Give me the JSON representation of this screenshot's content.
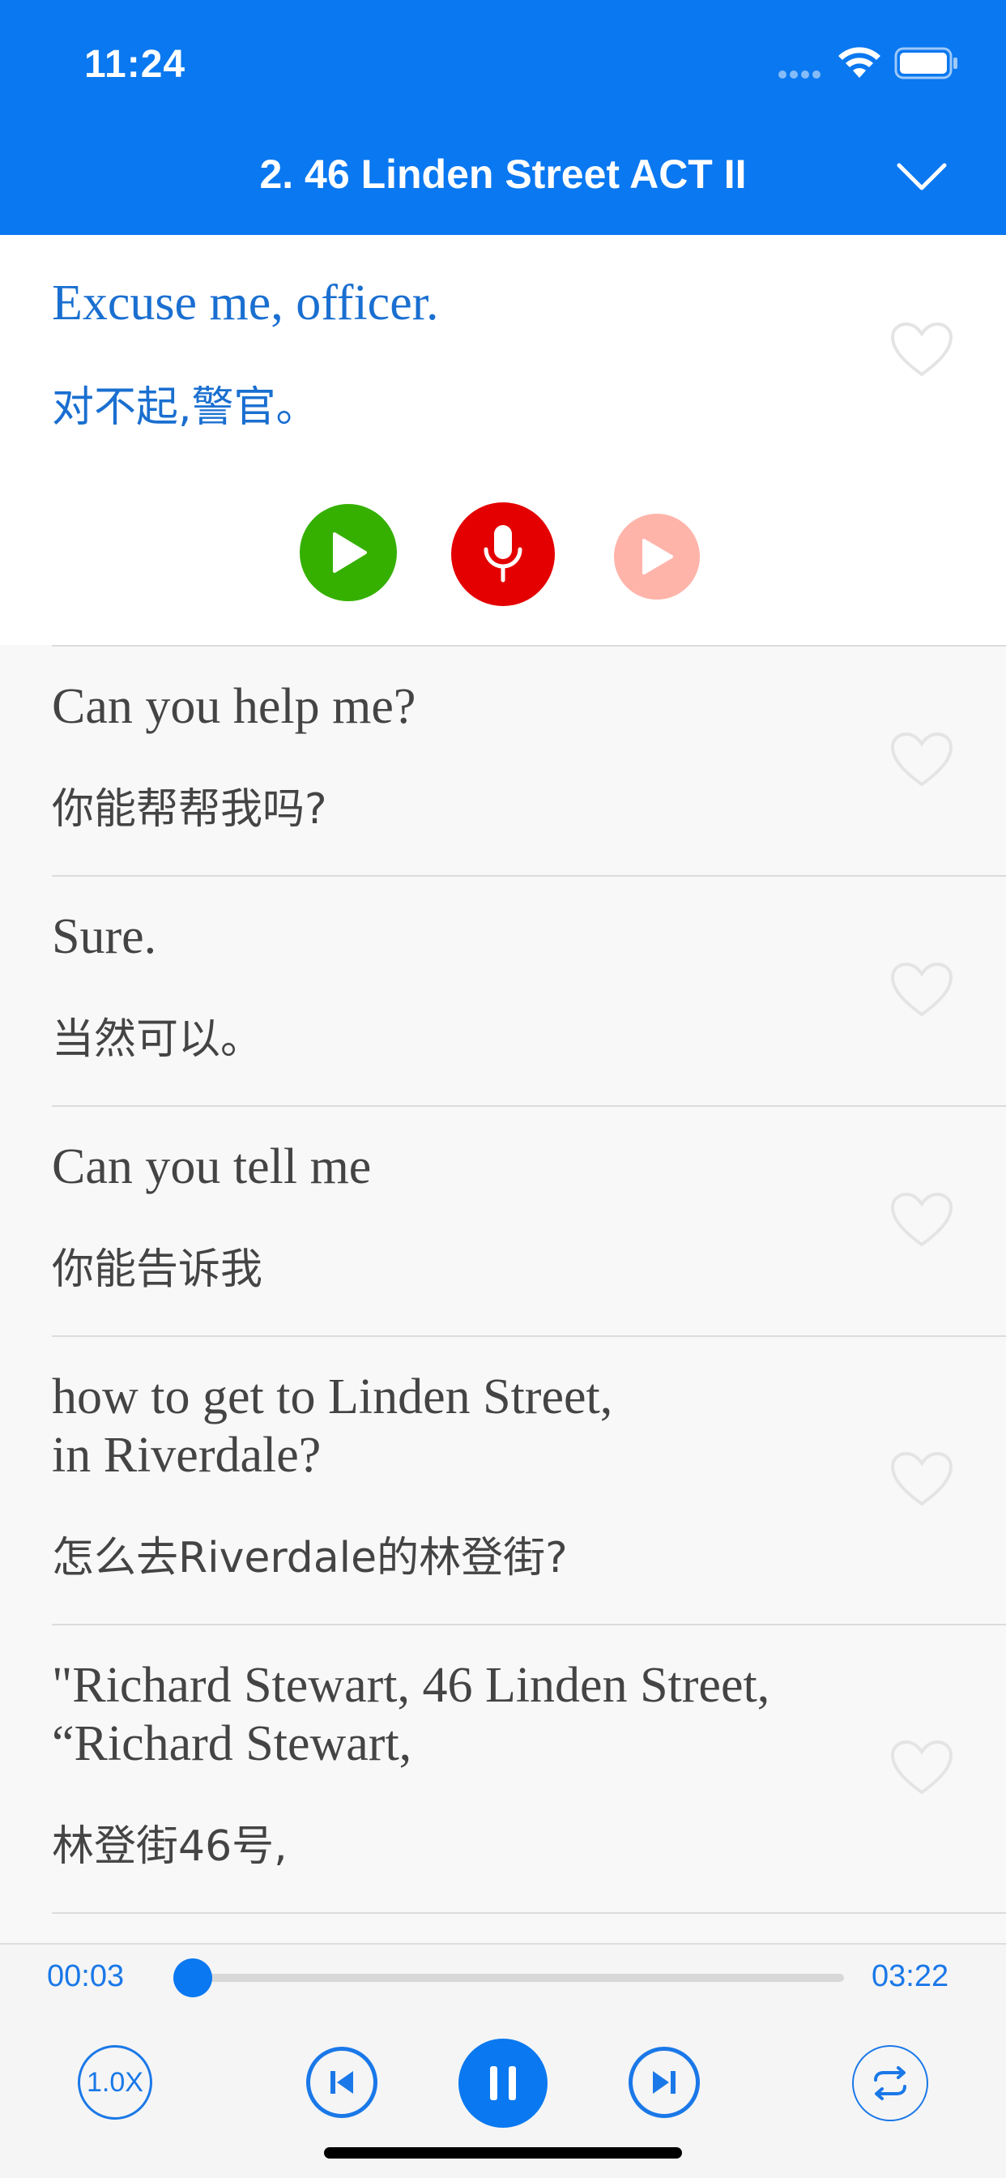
{
  "status_bar": {
    "time": "11:24"
  },
  "nav": {
    "title": "2. 46 Linden Street ACT II"
  },
  "active_sentence": {
    "en": "Excuse me, officer.",
    "zh": "对不起,警官。"
  },
  "sentences": [
    {
      "en": "Can you help me?",
      "zh": "你能帮帮我吗?"
    },
    {
      "en": "Sure.",
      "zh": "当然可以。"
    },
    {
      "en": "Can you tell me",
      "zh": "你能告诉我"
    },
    {
      "en": "how to get to Linden Street,\nin Riverdale?",
      "zh": "怎么去Riverdale的林登街?"
    },
    {
      "en": "\"Richard Stewart, 46 Linden Street,\n“Richard Stewart,",
      "zh": "林登街46号,"
    }
  ],
  "player": {
    "current_time": "00:03",
    "total_time": "03:22",
    "progress": 0.015,
    "speed": "1.0X"
  },
  "colors": {
    "primary": "#0a78f0",
    "active_text": "#1a6fd0",
    "play_green": "#35b000",
    "record_red": "#e40000",
    "playback_pink": "#ffb4aa"
  }
}
